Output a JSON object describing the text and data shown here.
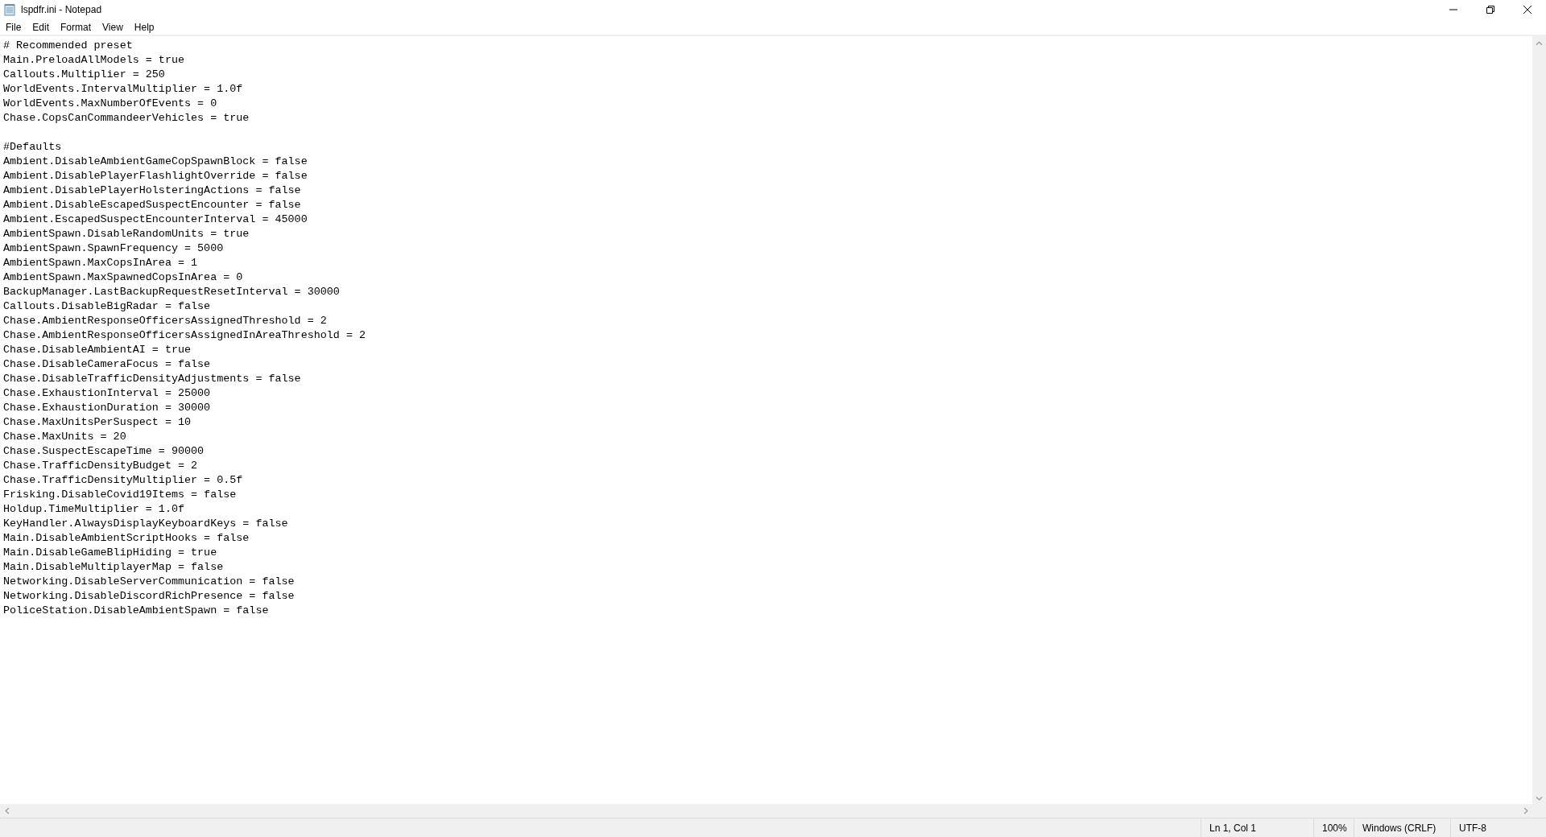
{
  "window": {
    "title": "lspdfr.ini - Notepad"
  },
  "menu": [
    "File",
    "Edit",
    "Format",
    "View",
    "Help"
  ],
  "editor": {
    "lines": [
      {
        "kind": "text",
        "text": "# Recommended preset"
      },
      {
        "kind": "text",
        "text": "Main.PreloadAllModels = true"
      },
      {
        "kind": "text",
        "text": "Callouts.Multiplier = 250"
      },
      {
        "kind": "text",
        "text": "WorldEvents.IntervalMultiplier = 1.0f"
      },
      {
        "kind": "text",
        "text": "WorldEvents.MaxNumberOfEvents = 0"
      },
      {
        "kind": "text",
        "text": "Chase.CopsCanCommandeerVehicles = true"
      },
      {
        "kind": "blank"
      },
      {
        "kind": "text",
        "text": "#Defaults"
      },
      {
        "kind": "text",
        "text": "Ambient.DisableAmbientGameCopSpawnBlock = false"
      },
      {
        "kind": "text",
        "text": "Ambient.DisablePlayerFlashlightOverride = false"
      },
      {
        "kind": "text",
        "text": "Ambient.DisablePlayerHolsteringActions = false"
      },
      {
        "kind": "text",
        "text": "Ambient.DisableEscapedSuspectEncounter = false"
      },
      {
        "kind": "text",
        "text": "Ambient.EscapedSuspectEncounterInterval = 45000"
      },
      {
        "kind": "text",
        "text": "AmbientSpawn.DisableRandomUnits = true"
      },
      {
        "kind": "text",
        "text": "AmbientSpawn.SpawnFrequency = 5000"
      },
      {
        "kind": "text",
        "text": "AmbientSpawn.MaxCopsInArea = 1"
      },
      {
        "kind": "text",
        "text": "AmbientSpawn.MaxSpawnedCopsInArea = 0"
      },
      {
        "kind": "text",
        "text": "BackupManager.LastBackupRequestResetInterval = 30000"
      },
      {
        "kind": "text",
        "text": "Callouts.DisableBigRadar = false"
      },
      {
        "kind": "text",
        "text": "Chase.AmbientResponseOfficersAssignedThreshold = 2"
      },
      {
        "kind": "text",
        "text": "Chase.AmbientResponseOfficersAssignedInAreaThreshold = 2"
      },
      {
        "kind": "text",
        "text": "Chase.DisableAmbientAI = true"
      },
      {
        "kind": "text",
        "text": "Chase.DisableCameraFocus = false"
      },
      {
        "kind": "text",
        "text": "Chase.DisableTrafficDensityAdjustments = false"
      },
      {
        "kind": "text",
        "text": "Chase.ExhaustionInterval = 25000"
      },
      {
        "kind": "text",
        "text": "Chase.ExhaustionDuration = 30000"
      },
      {
        "kind": "text",
        "text": "Chase.MaxUnitsPerSuspect = 10"
      },
      {
        "kind": "text",
        "text": "Chase.MaxUnits = 20"
      },
      {
        "kind": "text",
        "text": "Chase.SuspectEscapeTime = 90000"
      },
      {
        "kind": "text",
        "text": "Chase.TrafficDensityBudget = 2"
      },
      {
        "kind": "text",
        "text": "Chase.TrafficDensityMultiplier = 0.5f"
      },
      {
        "kind": "text",
        "text": "Frisking.DisableCovid19Items = false"
      },
      {
        "kind": "text",
        "text": "Holdup.TimeMultiplier = 1.0f"
      },
      {
        "kind": "text",
        "text": "KeyHandler.AlwaysDisplayKeyboardKeys = false"
      },
      {
        "kind": "text",
        "text": "Main.DisableAmbientScriptHooks = false"
      },
      {
        "kind": "text",
        "text": "Main.DisableGameBlipHiding = true"
      },
      {
        "kind": "text",
        "text": "Main.DisableMultiplayerMap = false"
      },
      {
        "kind": "text",
        "text": "Networking.DisableServerCommunication = false"
      },
      {
        "kind": "text",
        "text": "Networking.DisableDiscordRichPresence = false"
      },
      {
        "kind": "text",
        "text": "PoliceStation.DisableAmbientSpawn = false"
      }
    ]
  },
  "status_bar": [
    "Ln 1, Col 1",
    "100%",
    "Windows (CRLF)",
    "UTF-8"
  ]
}
